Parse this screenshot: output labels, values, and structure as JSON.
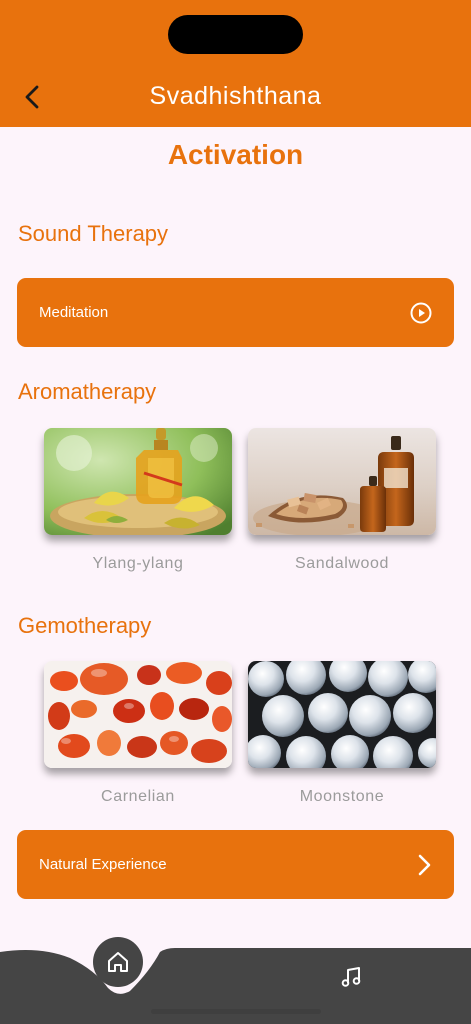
{
  "header": {
    "title": "Svadhishthana",
    "back_icon": "chevron-left-icon"
  },
  "page": {
    "title": "Activation"
  },
  "sound_therapy": {
    "title": "Sound Therapy",
    "button": {
      "label": "Meditation",
      "icon": "play-circle-icon"
    }
  },
  "aromatherapy": {
    "title": "Aromatherapy",
    "items": [
      {
        "label": "Ylang-ylang"
      },
      {
        "label": "Sandalwood"
      }
    ]
  },
  "gemotherapy": {
    "title": "Gemotherapy",
    "items": [
      {
        "label": "Carnelian"
      },
      {
        "label": "Moonstone"
      }
    ]
  },
  "natural_experience": {
    "label": "Natural Experience",
    "icon": "chevron-right-icon"
  },
  "bottom_nav": {
    "items": [
      {
        "icon": "home-icon"
      },
      {
        "icon": "music-note-icon"
      }
    ]
  },
  "colors": {
    "accent": "#e8720d",
    "background": "#fdf4fb",
    "nav": "#454545",
    "caption": "#9b9b9b"
  }
}
